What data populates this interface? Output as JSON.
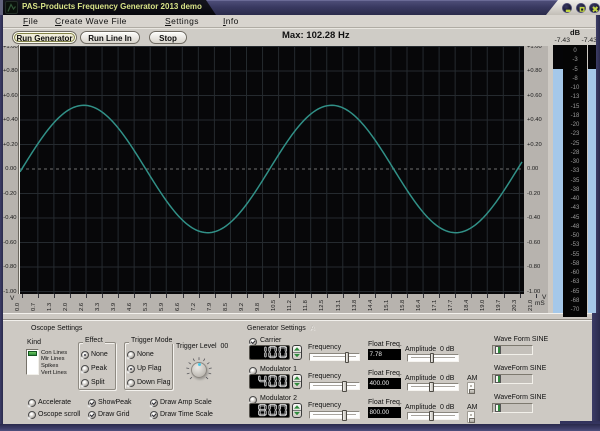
{
  "window": {
    "title": "PAS-Products Frequency Generator 2013 demo",
    "icon": "wave-peak-icon",
    "buttons": [
      {
        "name": "minimize",
        "glyph": "dash"
      },
      {
        "name": "maximize",
        "glyph": "square"
      },
      {
        "name": "close",
        "glyph": "x"
      }
    ],
    "button_glyph_color": "#c2d544"
  },
  "menu": {
    "items": [
      {
        "label": "File",
        "underline_index": 0
      },
      {
        "label": "Create Wave File",
        "underline_index": 0
      },
      {
        "label": "Settings",
        "underline_index": 0
      },
      {
        "label": "Info",
        "underline_index": 0
      }
    ]
  },
  "toolbar": {
    "buttons": [
      {
        "label": "Run Generator",
        "default": true
      },
      {
        "label": "Run Line In",
        "default": false
      },
      {
        "label": "Stop",
        "default": false
      }
    ],
    "max_label": "Max: 102.28 Hz"
  },
  "meter": {
    "unit": "dB",
    "left_value": "-7.43",
    "right_value": "-7.43",
    "level_db": -7.43,
    "range_db": 70,
    "scale": [
      0,
      -3,
      -5,
      -8,
      -10,
      -13,
      -15,
      -18,
      -20,
      -23,
      -25,
      -28,
      -30,
      -33,
      -35,
      -38,
      -40,
      -43,
      -45,
      -48,
      -50,
      -53,
      -55,
      -58,
      -60,
      -63,
      -65,
      -68,
      -70
    ],
    "bar_color": "#a5c8e9"
  },
  "scope": {
    "amp_unit": "V",
    "time_unit": "mS",
    "amp_labels": [
      "+1.00",
      "+0.80",
      "+0.60",
      "+0.40",
      "+0.20",
      "0.00",
      "-0.20",
      "-0.40",
      "-0.60",
      "-0.80",
      "-1.00"
    ],
    "time_labels": [
      "0.0",
      "0.7",
      "1.3",
      "2.0",
      "2.6",
      "3.3",
      "3.9",
      "4.6",
      "5.3",
      "5.9",
      "6.6",
      "7.2",
      "7.9",
      "8.5",
      "9.2",
      "9.8",
      "10.5",
      "11.2",
      "11.8",
      "12.5",
      "13.1",
      "13.8",
      "14.4",
      "15.1",
      "15.8",
      "16.4",
      "17.1",
      "17.7",
      "18.4",
      "19.0",
      "19.7",
      "20.3",
      "21.0"
    ],
    "time_span_ms": 21.0,
    "wave": {
      "shape": "sine",
      "color": "#319087",
      "amplitude_v": 0.52,
      "period_ms": 10.37,
      "start_phase_deg": 0
    },
    "grid_color": "#252a2f",
    "zero_line_color": "#6f6f6f"
  },
  "oscope_settings": {
    "title": "Oscope Settings",
    "kind": {
      "label": "Kind",
      "options": [
        "Con Lines",
        "Mir Lines",
        "Spikes",
        "Vert Lines"
      ],
      "selected_index": 0,
      "selected_color": "#2f8a3c"
    },
    "effect": {
      "title": "Effect",
      "options": [
        "None",
        "Peak",
        "Split"
      ],
      "selected_index": 0
    },
    "trigger_mode": {
      "title": "Trigger Mode",
      "options": [
        "None",
        "Up Flag",
        "Down Flag"
      ],
      "selected_index": 1
    },
    "trigger_level": {
      "label": "Trigger Level",
      "value": "00",
      "indicator_color": "#49c8e8"
    },
    "checkboxes": [
      {
        "label": "Accelerate",
        "checked": false
      },
      {
        "label": "Oscope scroll",
        "checked": false
      },
      {
        "label": "ShowPeak",
        "checked": true
      },
      {
        "label": "Draw Grid",
        "checked": true
      },
      {
        "label": "Draw Amp Scale",
        "checked": true
      },
      {
        "label": "Draw Time Scale",
        "checked": true
      }
    ]
  },
  "generator_settings": {
    "title": "Generator Settings",
    "rows": [
      {
        "name": "Carrier",
        "checked": true,
        "led_value": "100",
        "freq_label": "Frequency",
        "freq_slider_pos": 0.75,
        "float_label": "Float Freq.",
        "float_value": "7.78",
        "amp_label": "Amplitude  0 dB",
        "amp_slider_pos": 0.47,
        "has_am": false,
        "am_label": "AM",
        "waveform_label": "Wave Form SINE"
      },
      {
        "name": "Modulator 1",
        "checked": false,
        "led_value": "400",
        "freq_label": "Frequency",
        "freq_slider_pos": 0.69,
        "float_label": "Float Freq.",
        "float_value": "400.00",
        "amp_label": "Amplitude  0 dB",
        "amp_slider_pos": 0.46,
        "has_am": true,
        "am_label": "AM",
        "waveform_label": "WaveForm SINE"
      },
      {
        "name": "Modulator 2",
        "checked": false,
        "led_value": "800",
        "freq_label": "Frequency",
        "freq_slider_pos": 0.69,
        "float_label": "Float Freq.",
        "float_value": "800.00",
        "amp_label": "Amplitude  0 dB",
        "amp_slider_pos": 0.46,
        "has_am": true,
        "am_label": "AM",
        "waveform_label": "WaveForm SINE"
      }
    ]
  }
}
